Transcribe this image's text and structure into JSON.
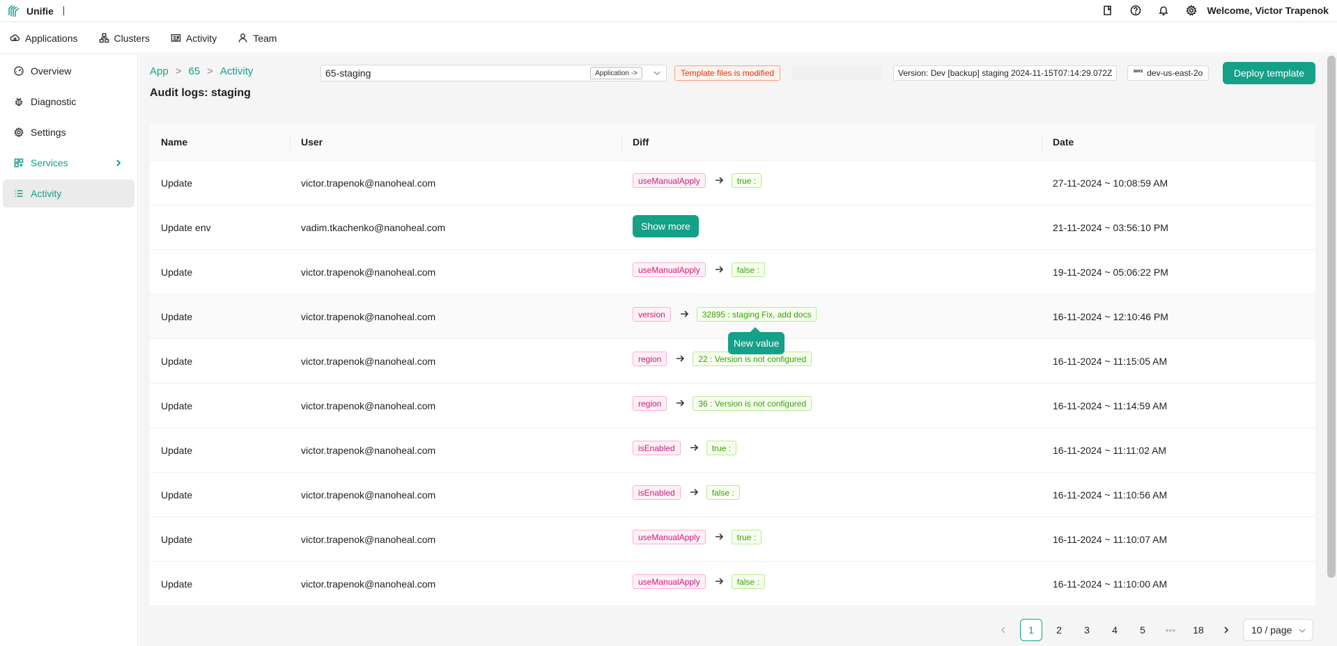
{
  "brand": {
    "name": "Unifie"
  },
  "topbar": {
    "welcome": "Welcome, Victor Trapenok"
  },
  "nav": [
    {
      "label": "Applications",
      "icon": "cloud-icon"
    },
    {
      "label": "Clusters",
      "icon": "cluster-icon"
    },
    {
      "label": "Activity",
      "icon": "news-icon"
    },
    {
      "label": "Team",
      "icon": "user-icon"
    }
  ],
  "sidebar": [
    {
      "label": "Overview"
    },
    {
      "label": "Diagnostic"
    },
    {
      "label": "Settings"
    },
    {
      "label": "Services"
    },
    {
      "label": "Activity"
    }
  ],
  "breadcrumb": [
    "App",
    "65",
    "Activity"
  ],
  "page_title": "Audit logs: staging",
  "app_select": {
    "value": "65-staging",
    "tag": "Application ->"
  },
  "warning": "Template files is modified",
  "version": "Version: Dev [backup] staging 2024-11-15T07:14:29.072Z",
  "region": {
    "provider": "aws",
    "label": "dev-us-east-2o"
  },
  "deploy_label": "Deploy template",
  "table": {
    "columns": [
      "Name",
      "User",
      "Diff",
      "Date"
    ],
    "rows": [
      {
        "name": "Update",
        "user": "victor.trapenok@nanoheal.com",
        "key": "useManualApply",
        "value": "true :",
        "date": "27-11-2024 ~ 10:08:59 AM"
      },
      {
        "name": "Update env",
        "user": "vadim.tkachenko@nanoheal.com",
        "show_more": "Show more",
        "date": "21-11-2024 ~ 03:56:10 PM"
      },
      {
        "name": "Update",
        "user": "victor.trapenok@nanoheal.com",
        "key": "useManualApply",
        "value": "false :",
        "date": "19-11-2024 ~ 05:06:22 PM"
      },
      {
        "name": "Update",
        "user": "victor.trapenok@nanoheal.com",
        "key": "version",
        "value": "32895 : staging Fix, add docs",
        "date": "16-11-2024 ~ 12:10:46 PM"
      },
      {
        "name": "Update",
        "user": "victor.trapenok@nanoheal.com",
        "key": "region",
        "value": "22 : Version is not configured",
        "date": "16-11-2024 ~ 11:15:05 AM"
      },
      {
        "name": "Update",
        "user": "victor.trapenok@nanoheal.com",
        "key": "region",
        "value": "36 : Version is not configured",
        "date": "16-11-2024 ~ 11:14:59 AM"
      },
      {
        "name": "Update",
        "user": "victor.trapenok@nanoheal.com",
        "key": "isEnabled",
        "value": "true :",
        "date": "16-11-2024 ~ 11:11:02 AM"
      },
      {
        "name": "Update",
        "user": "victor.trapenok@nanoheal.com",
        "key": "isEnabled",
        "value": "false :",
        "date": "16-11-2024 ~ 11:10:56 AM"
      },
      {
        "name": "Update",
        "user": "victor.trapenok@nanoheal.com",
        "key": "useManualApply",
        "value": "true :",
        "date": "16-11-2024 ~ 11:10:07 AM"
      },
      {
        "name": "Update",
        "user": "victor.trapenok@nanoheal.com",
        "key": "useManualApply",
        "value": "false :",
        "date": "16-11-2024 ~ 11:10:00 AM"
      }
    ]
  },
  "tooltip": "New value",
  "pagination": {
    "pages": [
      "1",
      "2",
      "3",
      "4",
      "5"
    ],
    "ellipsis": "•••",
    "last": "18",
    "page_size": "10 / page"
  },
  "colors": {
    "accent": "#15a088",
    "warning": "#d4380d",
    "key_tag": "#c41d7f",
    "value_tag": "#389e0d"
  }
}
